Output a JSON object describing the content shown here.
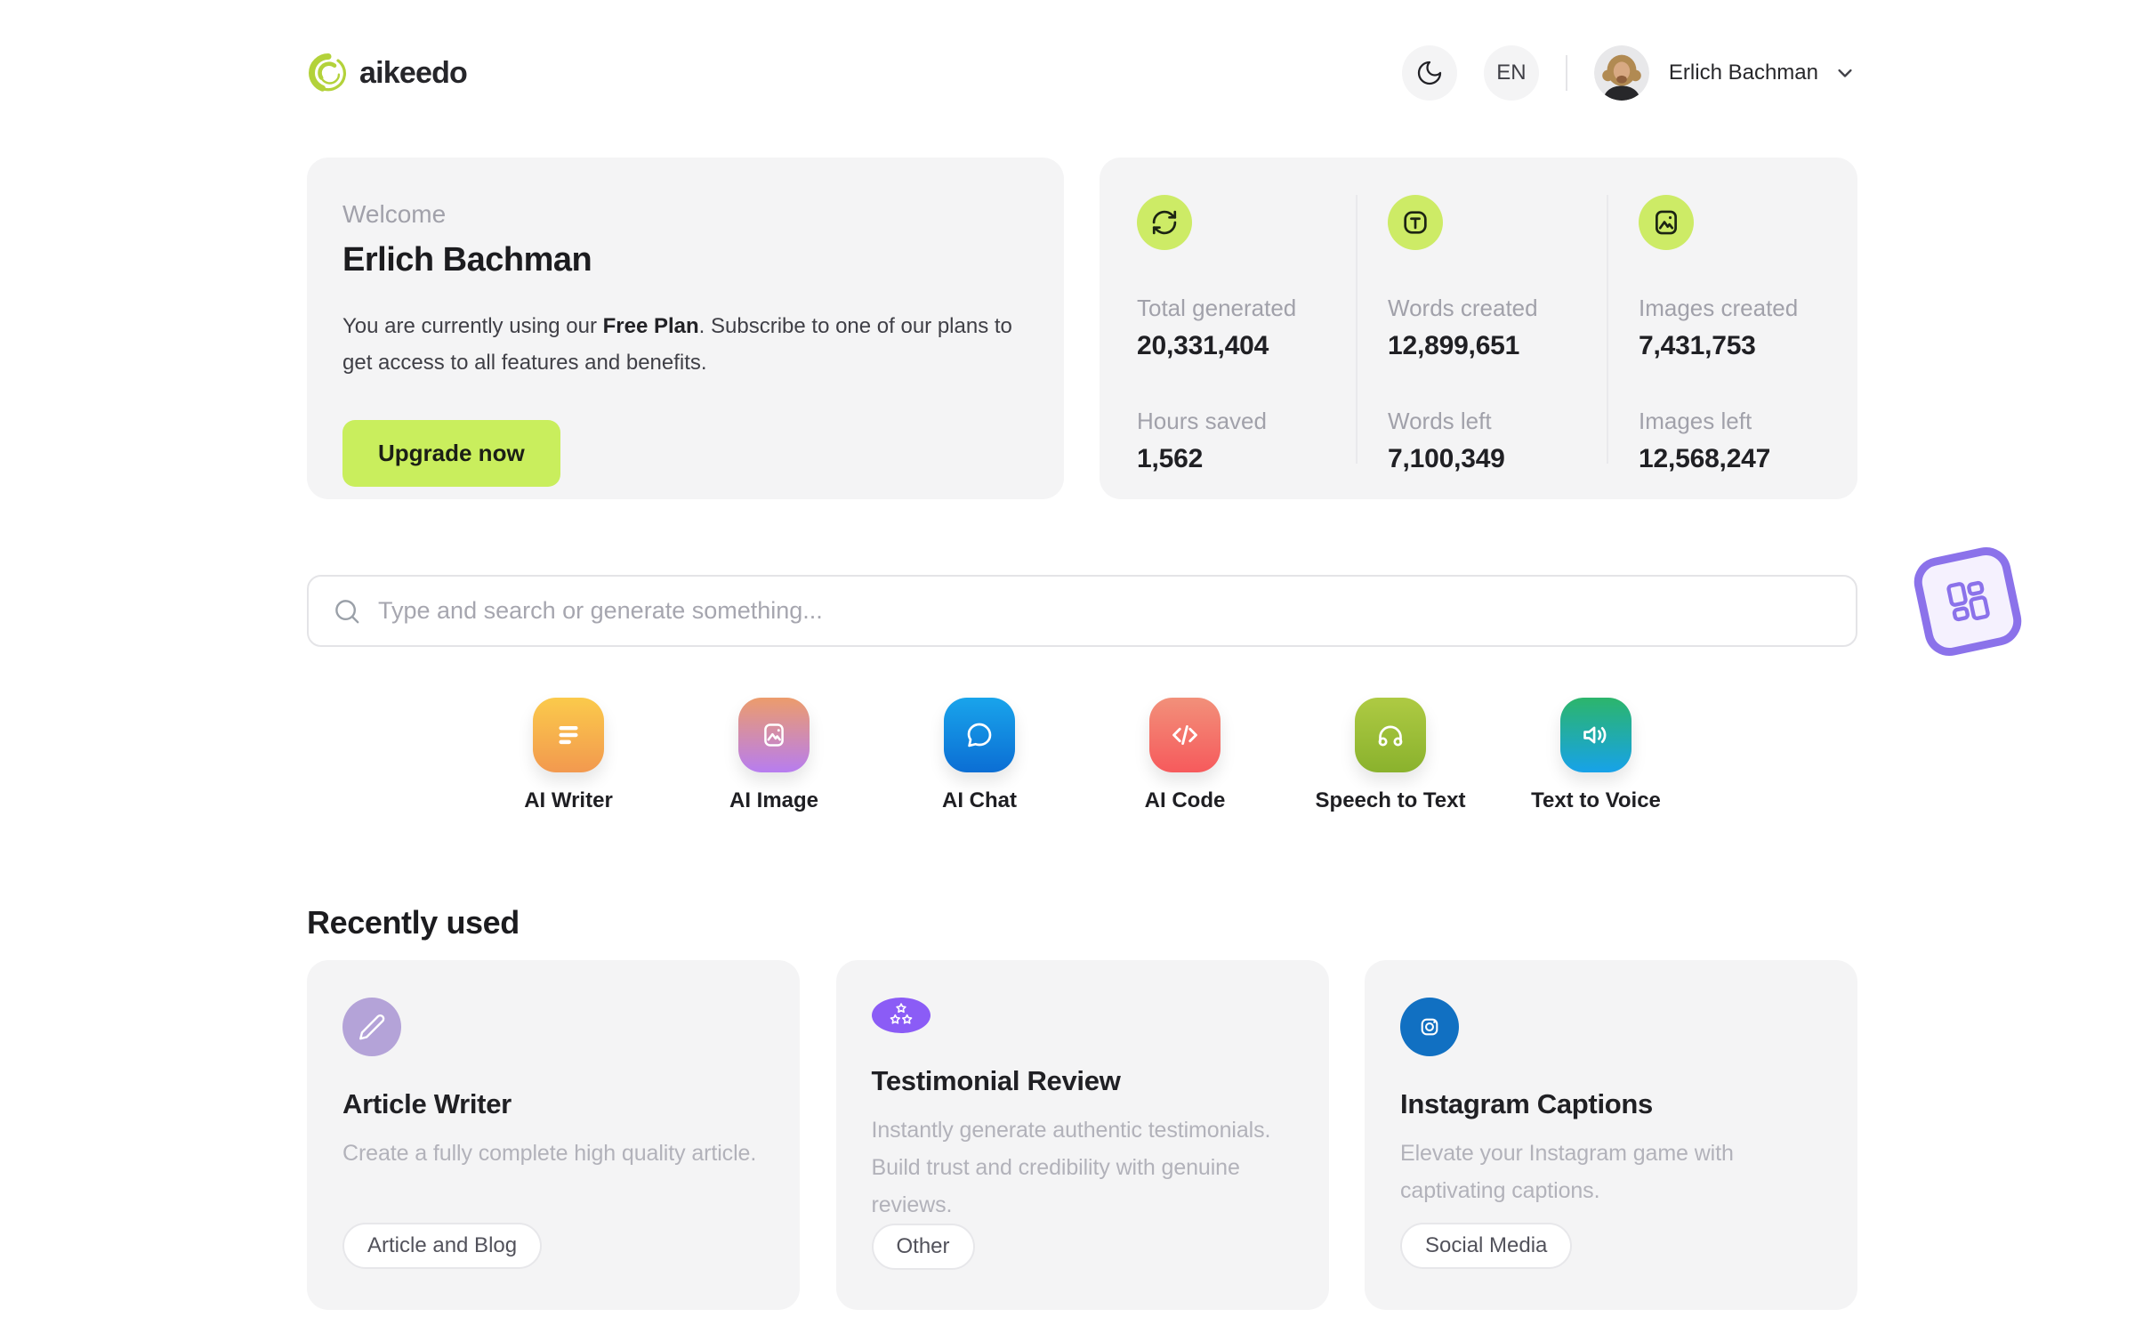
{
  "header": {
    "brand": "aikeedo",
    "theme_toggle_icon": "moon-icon",
    "language": "EN",
    "user_name": "Erlich Bachman"
  },
  "welcome": {
    "eyebrow": "Welcome",
    "name": "Erlich Bachman",
    "body_prefix": "You are currently using our ",
    "plan_name": "Free Plan",
    "body_suffix": ". Subscribe to one of our plans to get access to all features and benefits.",
    "cta_label": "Upgrade now"
  },
  "stats": {
    "columns": [
      {
        "icon": "refresh-icon",
        "rows": [
          {
            "label": "Total generated",
            "value": "20,331,404"
          },
          {
            "label": "Hours saved",
            "value": "1,562"
          }
        ]
      },
      {
        "icon": "text-icon",
        "rows": [
          {
            "label": "Words created",
            "value": "12,899,651"
          },
          {
            "label": "Words left",
            "value": "7,100,349"
          }
        ]
      },
      {
        "icon": "image-icon",
        "rows": [
          {
            "label": "Images created",
            "value": "7,431,753"
          },
          {
            "label": "Images left",
            "value": "12,568,247"
          }
        ]
      }
    ]
  },
  "search": {
    "placeholder": "Type and search or generate something...",
    "icon": "search-icon"
  },
  "tools": [
    {
      "label": "AI Writer",
      "icon": "writer-lines-icon",
      "gradient": [
        "#fbca4b",
        "#f2994f"
      ]
    },
    {
      "label": "AI Image",
      "icon": "image-icon",
      "gradient": [
        "#ec9c6c",
        "#b77df0"
      ]
    },
    {
      "label": "AI Chat",
      "icon": "chat-bubble-icon",
      "gradient": [
        "#19a4eb",
        "#0b6ed4"
      ]
    },
    {
      "label": "AI Code",
      "icon": "code-icon",
      "gradient": [
        "#f2907a",
        "#f65a5c"
      ]
    },
    {
      "label": "Speech to Text",
      "icon": "headphones-icon",
      "gradient": [
        "#aeca43",
        "#8ab22d"
      ]
    },
    {
      "label": "Text to Voice",
      "icon": "speaker-icon",
      "gradient": [
        "#2cb56b",
        "#17a2e9"
      ]
    }
  ],
  "recent": {
    "heading": "Recently used",
    "cards": [
      {
        "title": "Article Writer",
        "description": "Create a fully complete high quality article.",
        "badge": "Article and Blog",
        "icon": "pencil-icon",
        "icon_color": "#b4a3d8"
      },
      {
        "title": "Testimonial Review",
        "description": "Instantly generate authentic testimonials. Build trust and credibility with genuine reviews.",
        "badge": "Other",
        "icon": "stars-icon",
        "icon_color": "#8b5cf6"
      },
      {
        "title": "Instagram Captions",
        "description": "Elevate your Instagram game with captivating captions.",
        "badge": "Social Media",
        "icon": "instagram-icon",
        "icon_color": "#1170c2"
      }
    ]
  },
  "colors": {
    "accent_lime": "#c9ee5d",
    "stat_icon_lime": "#cdeb66",
    "card_background": "#f4f4f5",
    "sticker_purple": "#8b72ea",
    "text_dark": "#18181b",
    "text_muted": "#a1a1aa"
  }
}
